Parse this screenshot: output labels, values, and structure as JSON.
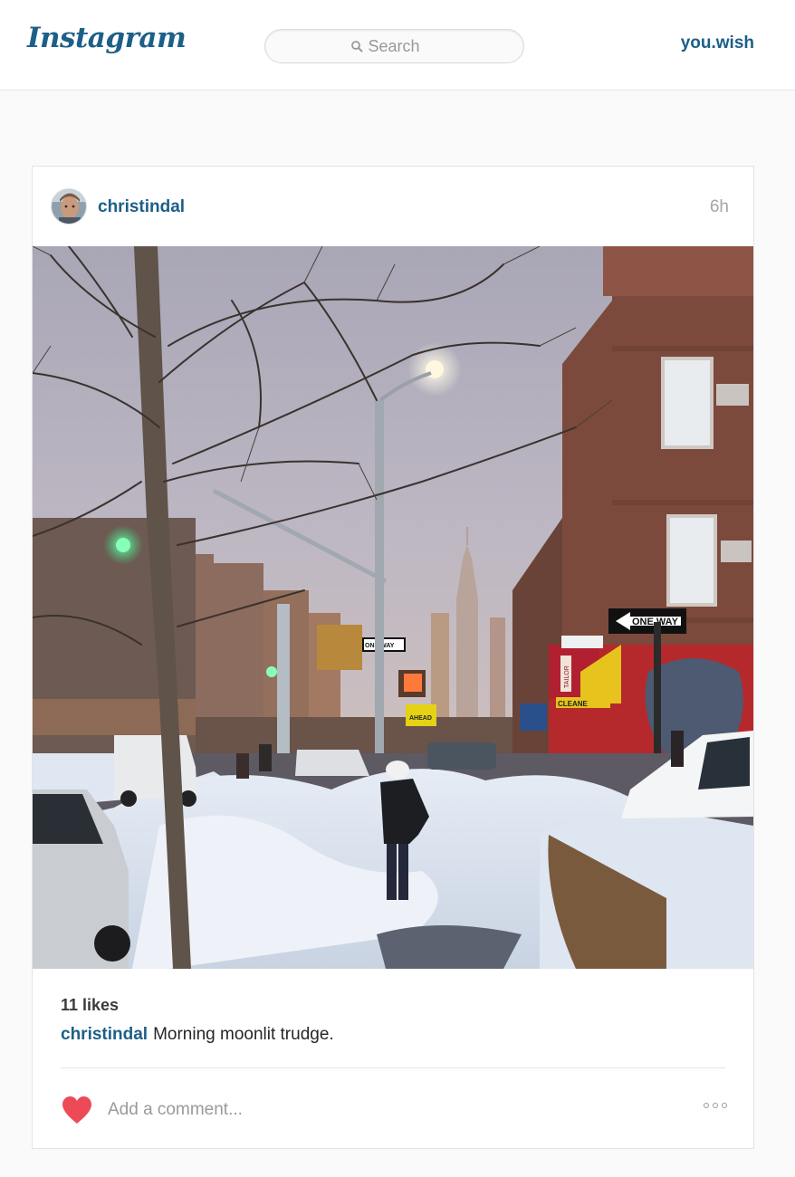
{
  "header": {
    "logo_text": "Instagram",
    "search_placeholder": "Search",
    "current_user": "you.wish"
  },
  "post": {
    "author": "christindal",
    "time_ago": "6h",
    "likes_text": "11 likes",
    "caption_author": "christindal",
    "caption_text": "Morning moonlit trudge.",
    "comment_placeholder": "Add a comment...",
    "photo_signs": {
      "one_way_main": "ONE WAY",
      "one_way_small": "ONE WAY",
      "ahead": "AHEAD",
      "tailor": "TAILOR",
      "cleaners": "CLEANE"
    }
  },
  "colors": {
    "brand_blue": "#1c5f88",
    "heart_red": "#ed4956",
    "background": "#fafafa"
  },
  "icons": [
    "instagram-logo",
    "search-icon",
    "avatar",
    "heart-icon",
    "more-options-icon"
  ]
}
